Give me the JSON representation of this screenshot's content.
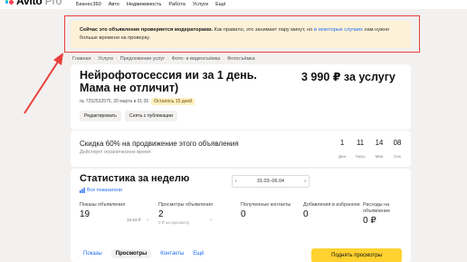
{
  "header": {
    "logo_text": "Avito",
    "logo_pro": "Pro",
    "nav": [
      "Бизнес360",
      "Авто",
      "Недвижимость",
      "Работа",
      "Услуги",
      "Ещё"
    ]
  },
  "banner": {
    "bold": "Сейчас это объявление проверяется модераторами.",
    "text": " Как правило, это занимает пару минут, но ",
    "link": "в некоторых случаях",
    "text2": " нам нужно больше времени на проверку."
  },
  "breadcrumb": [
    "Главная",
    "Услуги",
    "Предложение услуг",
    "Фото- и видеосъёмка",
    "Фотосъёмка"
  ],
  "listing": {
    "title": "Нейрофотосессия ии за 1 день. Мама не отличит)",
    "price": "3 990 ₽ за услугу",
    "meta": "№ 7252532575, 20 марта в 01:35",
    "days_left": "Осталось 15 дней",
    "edit_label": "Редактировать",
    "unpublish_label": "Снять с публикации"
  },
  "promo": {
    "title": "Скидка 60% на продвижение этого объявления",
    "subtitle": "Действует ограниченное время",
    "timer": [
      {
        "num": "1",
        "unit": "Дни"
      },
      {
        "num": "11",
        "unit": "Часы"
      },
      {
        "num": "14",
        "unit": "Мин"
      },
      {
        "num": "08",
        "unit": "Сек"
      }
    ]
  },
  "stats": {
    "title": "Статистика за неделю",
    "all_metrics": "Все показатели",
    "date_range": "31.03–06.04",
    "rub_small": "10,53 ₽",
    "metrics": [
      {
        "label": "Показы объявления",
        "value": "19",
        "sub": ""
      },
      {
        "label": "Просмотры объявления",
        "value": "2",
        "sub": "0 ₽ за просмотр"
      },
      {
        "label": "Полученные контакты",
        "value": "0",
        "sub": ""
      },
      {
        "label": "Добавления в избранное",
        "value": "0",
        "sub": ""
      },
      {
        "label": "Расходы на объявление",
        "value": "0 ₽",
        "sub": ""
      }
    ],
    "tabs": [
      "Показы",
      "Просмотры",
      "Контакты",
      "Ещё"
    ],
    "raise_label": "Поднять просмотры"
  },
  "colors": {
    "accent_red": "#e8403c",
    "banner_bg": "#fdf1d7",
    "link_blue": "#1d6cf2",
    "cta_yellow": "#ffd230"
  }
}
